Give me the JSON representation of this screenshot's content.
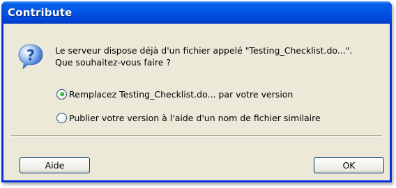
{
  "window": {
    "title": "Contribute"
  },
  "dialog": {
    "icon": "question-icon",
    "message_line1": "Le serveur dispose déjà d'un fichier appelé \"Testing_Checklist.do...\".",
    "message_line2": "Que souhaitez-vous faire ?",
    "options": [
      {
        "label": "Remplacez Testing_Checklist.do... par votre version",
        "selected": true
      },
      {
        "label": "Publier votre version à l'aide d'un nom de fichier similaire",
        "selected": false
      }
    ]
  },
  "buttons": {
    "help_label": "Aide",
    "ok_label": "OK"
  },
  "colors": {
    "titlebar": "#0055e5",
    "client_bg": "#ece9d8",
    "radio_selected": "#21a121"
  }
}
